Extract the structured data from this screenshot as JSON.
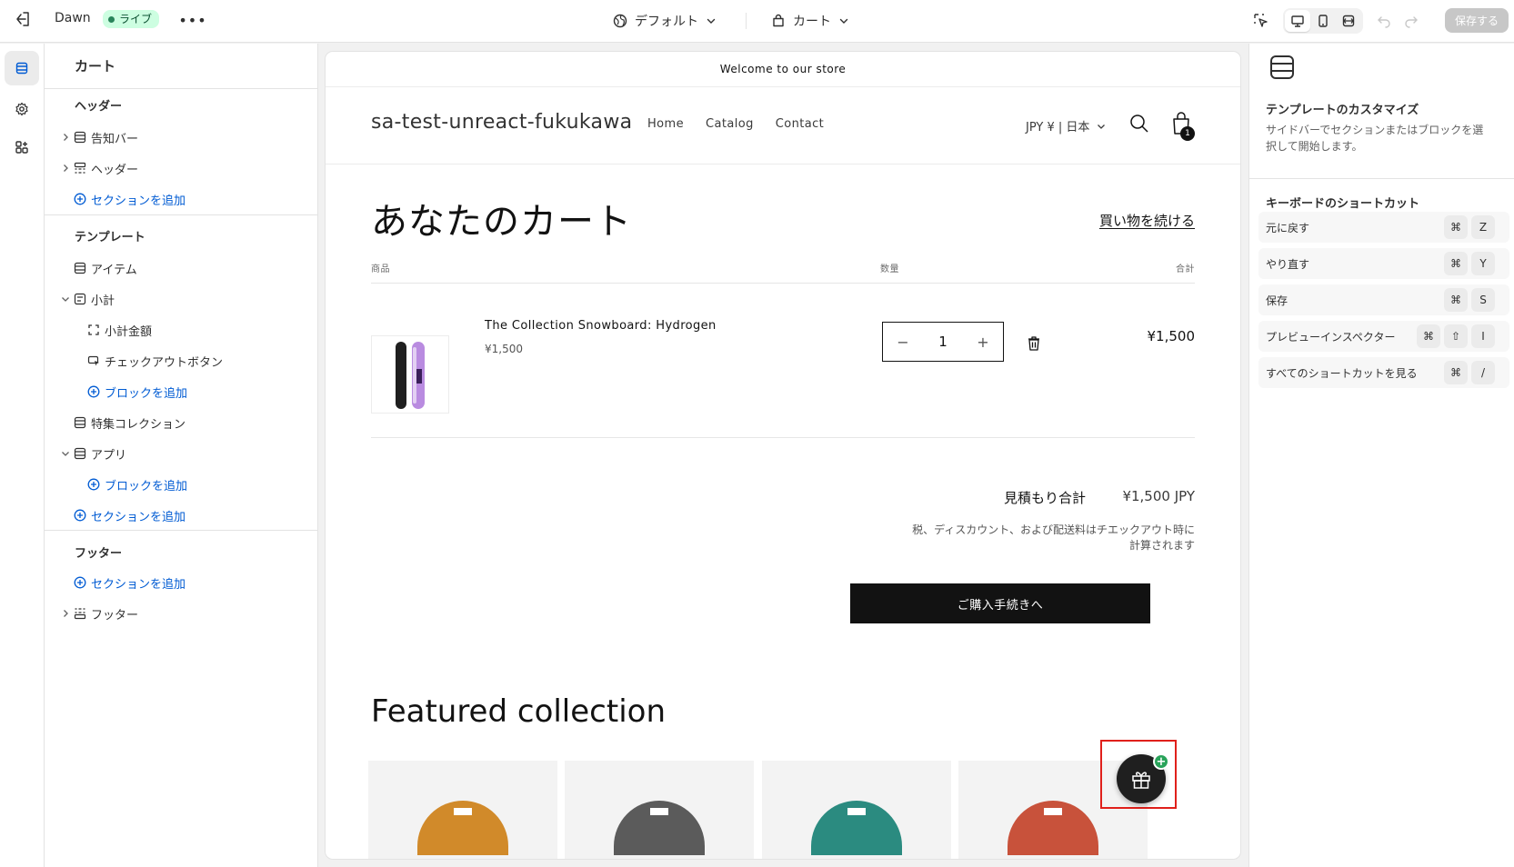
{
  "topbar": {
    "theme_name": "Dawn",
    "status_badge": "ライブ",
    "more_label": "•••",
    "context_theme": "デフォルト",
    "context_page": "カート",
    "save_label": "保存する"
  },
  "sidebar": {
    "title": "カート",
    "groups": {
      "header": {
        "label": "ヘッダー",
        "items": [
          "告知バー",
          "ヘッダー"
        ],
        "add_section": "セクションを追加"
      },
      "template": {
        "label": "テンプレート",
        "items": [
          "アイテム",
          "小計",
          "小計金額",
          "チェックアウトボタン",
          "特集コレクション",
          "アプリ"
        ],
        "add_block": "ブロックを追加",
        "add_section": "セクションを追加"
      },
      "footer": {
        "label": "フッター",
        "add_section": "セクションを追加",
        "items": [
          "フッター"
        ]
      }
    }
  },
  "preview": {
    "announcement": "Welcome to our store",
    "store_name": "sa-test-unreact-fukukawa",
    "nav": [
      "Home",
      "Catalog",
      "Contact"
    ],
    "currency": "JPY ¥ | 日本",
    "cart_count": "1",
    "cart_title": "あなたのカート",
    "continue_shopping": "買い物を続ける",
    "columns": {
      "product": "商品",
      "quantity": "数量",
      "total": "合計"
    },
    "item": {
      "name": "The Collection Snowboard: Hydrogen",
      "price": "¥1,500",
      "quantity": "1",
      "line_total": "¥1,500"
    },
    "estimated_label": "見積もり合計",
    "estimated_value": "¥1,500 JPY",
    "tax_note_line1": "税、ディスカウント、および配送料はチエックアウト時に",
    "tax_note_line2": "計算されます",
    "checkout_label": "ご購入手続きへ",
    "featured_title": "Featured collection",
    "featured_colors": [
      "#d18a2a",
      "#5b5b5b",
      "#2b8b80",
      "#c8523b"
    ],
    "gift_plus": "+"
  },
  "right_panel": {
    "title": "テンプレートのカスタマイズ",
    "desc": "サイドバーでセクションまたはブロックを選択して開始します。",
    "shortcuts_title": "キーボードのショートカット",
    "shortcuts": [
      {
        "label": "元に戻す",
        "keys": [
          "⌘",
          "Z"
        ]
      },
      {
        "label": "やり直す",
        "keys": [
          "⌘",
          "Y"
        ]
      },
      {
        "label": "保存",
        "keys": [
          "⌘",
          "S"
        ]
      },
      {
        "label": "プレビューインスペクター",
        "keys": [
          "⌘",
          "⇧",
          "I"
        ]
      },
      {
        "label": "すべてのショートカットを見る",
        "keys": [
          "⌘",
          "/"
        ]
      }
    ]
  },
  "colors": {
    "accent": "#005bd3",
    "live_badge_bg": "#cdfee1",
    "live_badge_text": "#0c5132",
    "highlight_outline": "#e0201b",
    "checkout_bg": "#121212"
  }
}
